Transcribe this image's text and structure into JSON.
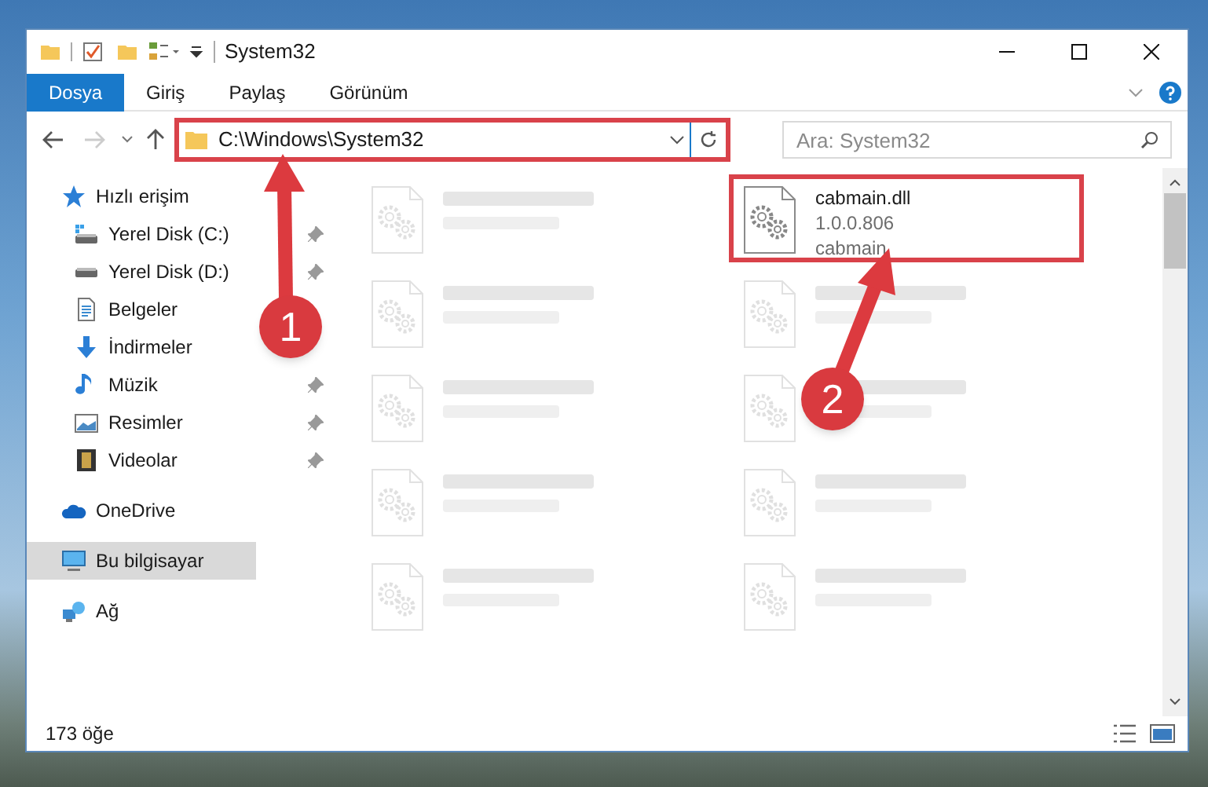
{
  "window": {
    "title": "System32"
  },
  "ribbon": {
    "tabs": [
      {
        "label": "Dosya",
        "selected": true
      },
      {
        "label": "Giriş",
        "selected": false
      },
      {
        "label": "Paylaş",
        "selected": false
      },
      {
        "label": "Görünüm",
        "selected": false
      }
    ]
  },
  "address": {
    "path": "C:\\Windows\\System32",
    "highlighted": true
  },
  "search": {
    "placeholder": "Ara: System32"
  },
  "sidebar": {
    "items": [
      {
        "label": "Hızlı erişim",
        "kind": "star",
        "selected": false,
        "children": [
          {
            "label": "Yerel Disk (C:)",
            "kind": "drive-c",
            "pinned": true,
            "selected": false
          },
          {
            "label": "Yerel Disk (D:)",
            "kind": "drive",
            "pinned": true,
            "selected": false
          },
          {
            "label": "Belgeler",
            "kind": "documents",
            "pinned": false,
            "selected": false
          },
          {
            "label": "İndirmeler",
            "kind": "download",
            "pinned": false,
            "selected": false
          },
          {
            "label": "Müzik",
            "kind": "music",
            "pinned": true,
            "selected": false
          },
          {
            "label": "Resimler",
            "kind": "pictures",
            "pinned": true,
            "selected": false
          },
          {
            "label": "Videolar",
            "kind": "videos",
            "pinned": true,
            "selected": false
          }
        ]
      },
      {
        "label": "OneDrive",
        "kind": "cloud",
        "selected": false
      },
      {
        "label": "Bu bilgisayar",
        "kind": "computer",
        "selected": true
      },
      {
        "label": "Ağ",
        "kind": "network",
        "selected": false
      }
    ]
  },
  "files": [
    {
      "kind": "blurred"
    },
    {
      "name": "cabmain.dll",
      "lines": [
        "1.0.0.806",
        "cabmain"
      ],
      "kind": "clear",
      "highlighted": true
    },
    {
      "kind": "blurred"
    },
    {
      "kind": "blurred"
    },
    {
      "kind": "blurred"
    },
    {
      "kind": "blurred"
    },
    {
      "kind": "blurred"
    },
    {
      "kind": "blurred"
    },
    {
      "kind": "blurred"
    },
    {
      "kind": "blurred"
    }
  ],
  "status_bar": {
    "count": "173 öğe"
  },
  "annotations": [
    {
      "label": "1"
    },
    {
      "label": "2"
    }
  ]
}
